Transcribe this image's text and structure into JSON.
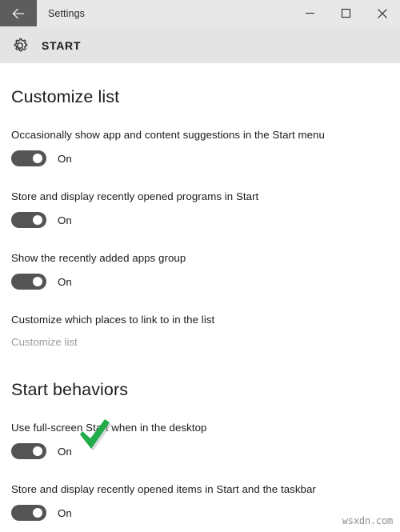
{
  "window": {
    "title": "Settings",
    "back_icon": "back-arrow-icon",
    "minimize_label": "—",
    "maximize_label": "□",
    "close_label": "✕"
  },
  "header": {
    "icon": "gear-icon",
    "title": "START",
    "background": "#e4e4e4"
  },
  "sections": [
    {
      "heading": "Customize list",
      "settings": [
        {
          "label": "Occasionally show app and content suggestions in the Start menu",
          "state": "On"
        },
        {
          "label": "Store and display recently opened programs in Start",
          "state": "On"
        },
        {
          "label": "Show the recently added apps group",
          "state": "On"
        }
      ],
      "link_label": "Customize which places to link to in the list",
      "link_text": "Customize list"
    },
    {
      "heading": "Start behaviors",
      "settings": [
        {
          "label": "Use full-screen Start when in the desktop",
          "state": "On"
        },
        {
          "label": "Store and display recently opened items in Start and the taskbar",
          "state": "On"
        }
      ]
    }
  ],
  "annotation": {
    "icon": "green-checkmark-icon",
    "color": "#22ac4b"
  },
  "watermark": {
    "text": "wsxdn.com"
  },
  "colors": {
    "toggle_on": "#545454",
    "titlebar": "#e8e8e8",
    "back_button": "#5d5d5d",
    "link": "#9b9b9b"
  }
}
